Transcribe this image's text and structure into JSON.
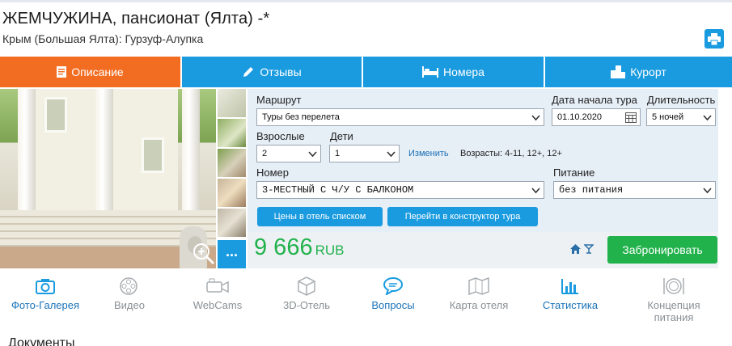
{
  "hotel": {
    "title": "ЖЕМЧУЖИНА, пансионат (Ялта) -*",
    "location": "Крым (Большая Ялта): Гурзуф-Алупка"
  },
  "toolbar": {
    "print_icon": "printer-icon"
  },
  "tabs": [
    {
      "label": "Описание",
      "icon": "document-icon",
      "active": true
    },
    {
      "label": "Отзывы",
      "icon": "pencil-icon",
      "active": false
    },
    {
      "label": "Номера",
      "icon": "bed-icon",
      "active": false
    },
    {
      "label": "Курорт",
      "icon": "buildings-icon",
      "active": false
    }
  ],
  "form": {
    "route_label": "Маршрут",
    "route_value": "Туры без перелета",
    "date_label": "Дата начала тура",
    "date_value": "01.10.2020",
    "duration_label": "Длительность",
    "duration_value": "5 ночей",
    "adults_label": "Взрослые",
    "adults_value": "2",
    "children_label": "Дети",
    "children_value": "1",
    "change_link": "Изменить",
    "ages_text": "Возрасты: 4-11, 12+, 12+",
    "room_label": "Номер",
    "room_value": "3-МЕСТНЫЙ С Ч/У С БАЛКОНОМ",
    "meal_label": "Питание",
    "meal_value": "без питания",
    "prices_list_button": "Цены в отель списком",
    "constructor_button": "Перейти в конструктор тура"
  },
  "price": {
    "amount": "9 666",
    "currency": "RUB"
  },
  "book_button": "Забронировать",
  "gallery": {
    "more_label": "..."
  },
  "features": [
    {
      "label": "Фото-Галерея",
      "icon": "camera-icon",
      "active": true
    },
    {
      "label": "Видео",
      "icon": "film-reel-icon",
      "active": false
    },
    {
      "label": "WebCams",
      "icon": "webcam-icon",
      "active": false
    },
    {
      "label": "3D-Отель",
      "icon": "3d-cube-icon",
      "active": false
    },
    {
      "label": "Вопросы",
      "icon": "chat-bubble-icon",
      "active": true
    },
    {
      "label": "Карта отеля",
      "icon": "map-icon",
      "active": false
    },
    {
      "label": "Статистика",
      "icon": "bar-chart-icon",
      "active": true
    },
    {
      "label": "Концепция питания",
      "icon": "plate-icon",
      "active": false
    }
  ],
  "documents_heading": "Документы",
  "colors": {
    "accent_blue": "#1a9be0",
    "active_tab_orange": "#f26d22",
    "price_green": "#22b24c"
  }
}
